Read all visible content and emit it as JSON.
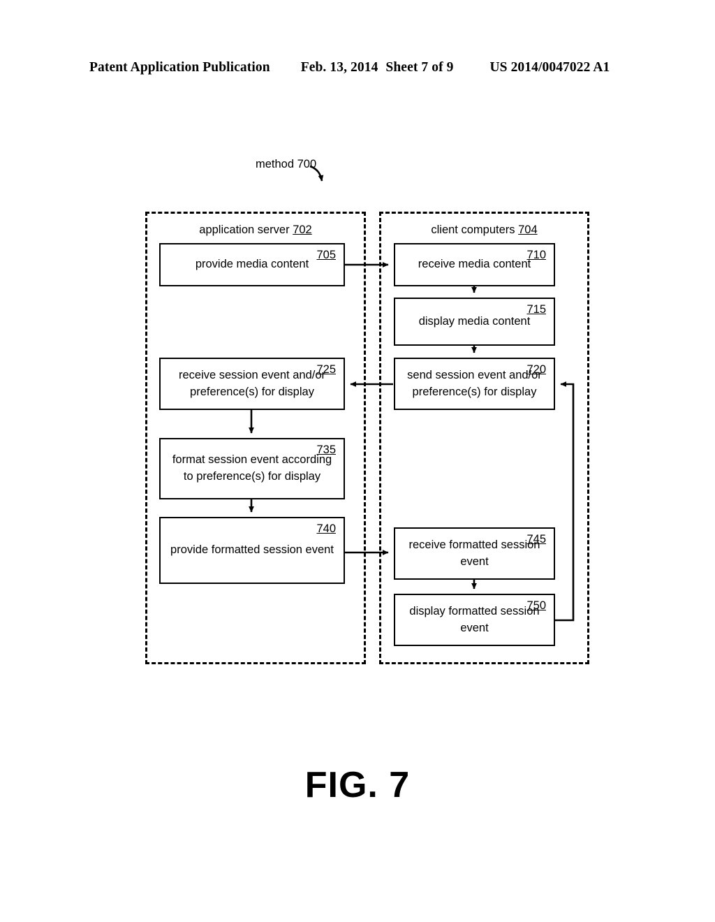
{
  "header": {
    "publication": "Patent Application Publication",
    "date": "Feb. 13, 2014",
    "sheet": "Sheet 7 of 9",
    "patent_number": "US 2014/0047022 A1"
  },
  "figure": {
    "caption": "FIG. 7",
    "method_label": "method 700"
  },
  "lanes": [
    {
      "id": "server",
      "label": "application server ",
      "ref": "702"
    },
    {
      "id": "client",
      "label": "client computers ",
      "ref": "704"
    }
  ],
  "boxes": {
    "b705": {
      "ref": "705",
      "text": "provide media content"
    },
    "b710": {
      "ref": "710",
      "text": "receive media content"
    },
    "b715": {
      "ref": "715",
      "text": "display media content"
    },
    "b720": {
      "ref": "720",
      "text": "send session event and/or preference(s) for display"
    },
    "b725": {
      "ref": "725",
      "text": "receive session event and/or preference(s) for display"
    },
    "b735": {
      "ref": "735",
      "text": "format session event according to preference(s) for display"
    },
    "b740": {
      "ref": "740",
      "text": "provide formatted session event"
    },
    "b745": {
      "ref": "745",
      "text": "receive formatted session event"
    },
    "b750": {
      "ref": "750",
      "text": "display formatted session event"
    }
  },
  "colors": {
    "ink": "#000000",
    "paper": "#ffffff"
  }
}
